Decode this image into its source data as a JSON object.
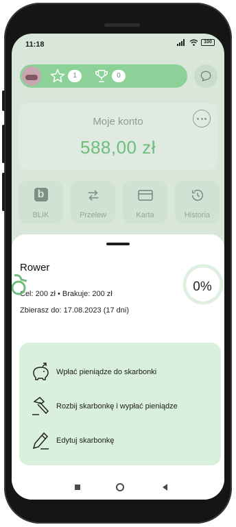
{
  "status_bar": {
    "time": "11:18",
    "battery": "100"
  },
  "profile": {
    "stars_count": "1",
    "trophies_count": "0"
  },
  "account": {
    "label": "Moje konto",
    "balance": "588,00 zł"
  },
  "quick_actions": [
    {
      "label": "BLIK",
      "icon": "blik-icon"
    },
    {
      "label": "Przelew",
      "icon": "transfer-icon"
    },
    {
      "label": "Karta",
      "icon": "card-icon"
    },
    {
      "label": "Historia",
      "icon": "history-icon"
    }
  ],
  "goal": {
    "title": "Rower",
    "details": "Cel: 200 zł • Brakuje: 200 zł",
    "deadline": "Zbierasz do: 17.08.2023 (17 dni)",
    "progress_text": "0%",
    "progress_fraction": 0
  },
  "options": [
    {
      "label": "Wpłać pieniądze do skarbonki",
      "icon": "piggy-bank-icon"
    },
    {
      "label": "Rozbij skarbonkę i wypłać pieniądze",
      "icon": "hammer-icon"
    },
    {
      "label": "Edytuj skarbonkę",
      "icon": "edit-icon"
    }
  ],
  "colors": {
    "accent_green": "#6fbd7e",
    "options_bg": "#d9f0dd",
    "pill_green": "#8bd198"
  }
}
